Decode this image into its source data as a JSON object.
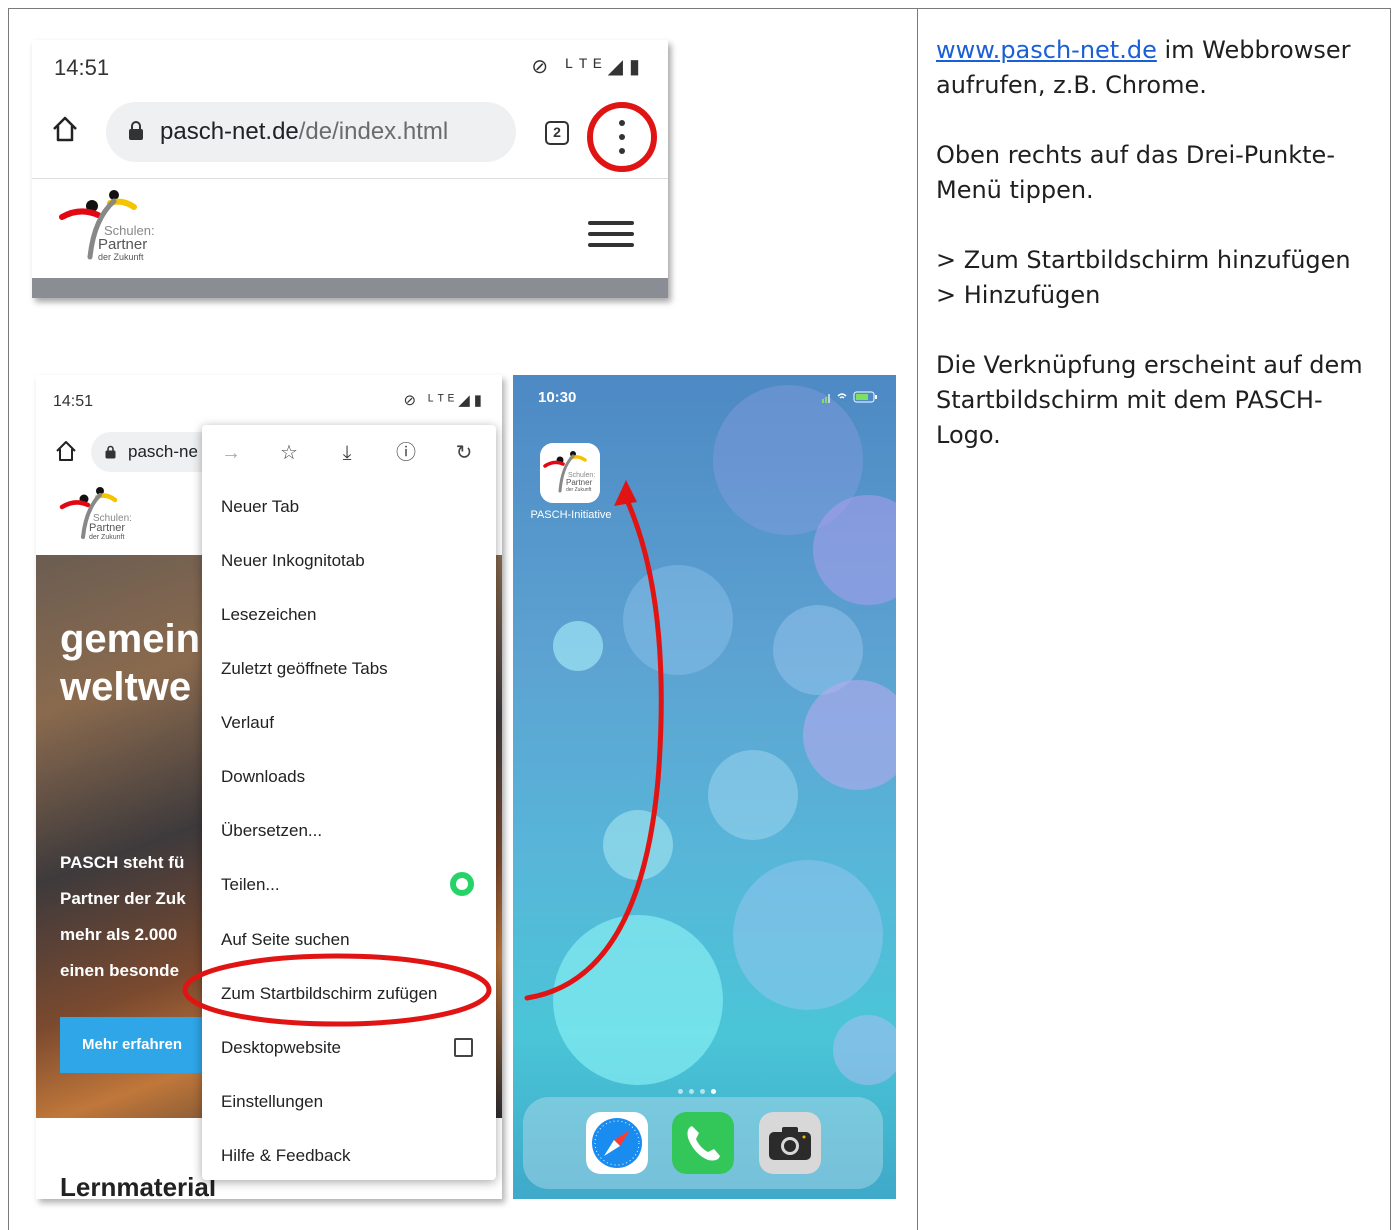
{
  "instructions": {
    "link_text": "www.pasch-net.de",
    "p1_rest": " im Webbrowser aufrufen, z.B. Chrome.",
    "p2": "Oben rechts auf das Drei-Punkte-Menü tippen.",
    "p3": "> Zum Startbildschirm hinzufügen > Hinzufügen",
    "p4": "Die Verknüpfung erscheint auf dem Startbildschirm mit dem PASCH-Logo."
  },
  "top_screenshot": {
    "time": "14:51",
    "status_icons": "⊘ ᴸᵀᴱ◢▮",
    "url_host": "pasch-net.de",
    "url_path": "/de/index.html",
    "tab_count": "2",
    "logo_line1": "Schulen:",
    "logo_line2": "Partner",
    "logo_line3": "der Zukunft"
  },
  "menu_screenshot": {
    "time": "14:51",
    "status_icons": "⊘ ᴸᵀᴱ◢▮",
    "url_partial": "pasch-ne",
    "logo_line1": "Schulen:",
    "logo_line2": "Partner",
    "logo_line3": "der Zukunft",
    "hero_heading_1": "gemein",
    "hero_heading_2": "weltwe",
    "hero_body": [
      "PASCH steht fü",
      "Partner der Zuk",
      "mehr als 2.000",
      "einen besonde"
    ],
    "hero_button": "Mehr erfahren",
    "section_heading": "Lernmaterial",
    "menu_icons": [
      "→",
      "☆",
      "⤓",
      "ⓘ",
      "↻"
    ],
    "menu_items": [
      "Neuer Tab",
      "Neuer Inkognitotab",
      "Lesezeichen",
      "Zuletzt geöffnete Tabs",
      "Verlauf",
      "Downloads",
      "Übersetzen...",
      "Teilen...",
      "Auf Seite suchen",
      "Zum Startbildschirm zufügen",
      "Desktopwebsite",
      "Einstellungen",
      "Hilfe & Feedback"
    ]
  },
  "ios_screenshot": {
    "time": "10:30",
    "app_label": "PASCH-Initiative",
    "app_logo_line1": "Schulen:",
    "app_logo_line2": "Partner",
    "app_logo_line3": "der Zukunft",
    "page_dots": 4,
    "active_page": 4,
    "dock_apps": [
      "safari-icon",
      "phone-icon",
      "camera-icon"
    ]
  },
  "colors": {
    "annotation_red": "#e11414",
    "link_blue": "#1a5fd6",
    "button_blue": "#2ea6e8",
    "whatsapp_green": "#25d366"
  }
}
